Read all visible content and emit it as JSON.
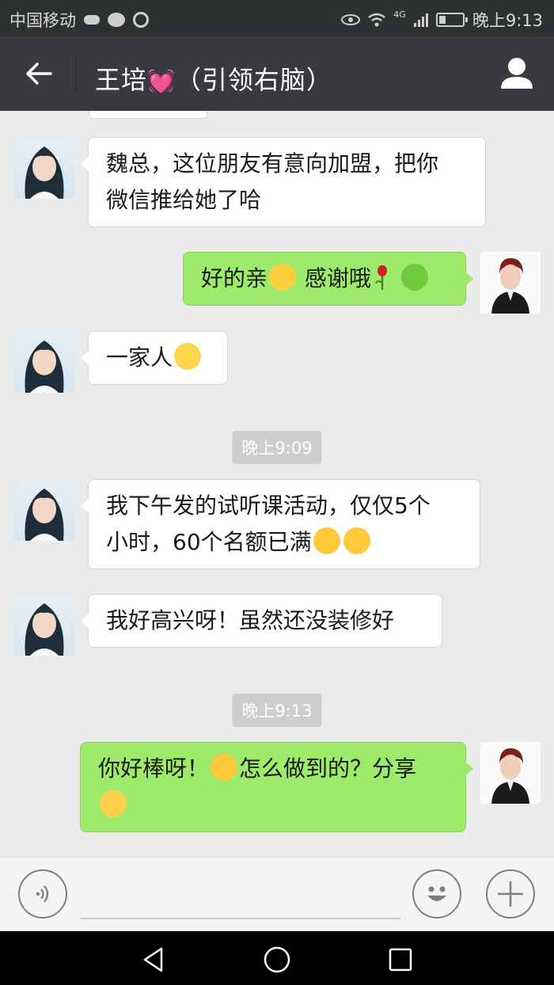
{
  "status_bar": {
    "carrier": "中国移动",
    "network": "4G",
    "time": "晚上9:13"
  },
  "header": {
    "contact_name": "王培",
    "contact_heart": "💓",
    "contact_suffix": "（引领右脑）"
  },
  "messages": [
    {
      "side": "in",
      "text_parts": [
        "魏总，这位朋友有意向加盟，把你",
        "微信推给她了哈"
      ]
    },
    {
      "side": "out",
      "text": "好的亲",
      "text2": "感谢哦"
    },
    {
      "side": "in",
      "text": "一家人"
    },
    {
      "type": "time",
      "text": "晚上9:09"
    },
    {
      "side": "in",
      "text_parts": [
        "我下午发的试听课活动，仅仅5个",
        "小时，60个名额已满"
      ]
    },
    {
      "side": "in",
      "text": "我好高兴呀！虽然还没装修好"
    },
    {
      "type": "time",
      "text": "晚上9:13"
    },
    {
      "side": "out",
      "text": "你好棒呀！",
      "text2": "怎么做到的？分享"
    }
  ],
  "icons": {
    "back": "arrow-left-icon",
    "profile": "person-icon",
    "voice": "voice-icon",
    "emoji": "emoji-icon",
    "plus": "plus-icon"
  },
  "colors": {
    "header_bg": "#393a3f",
    "status_bg": "#2e3132",
    "chat_bg": "#ebebeb",
    "out_bubble": "#9eea6a",
    "in_bubble": "#ffffff"
  }
}
